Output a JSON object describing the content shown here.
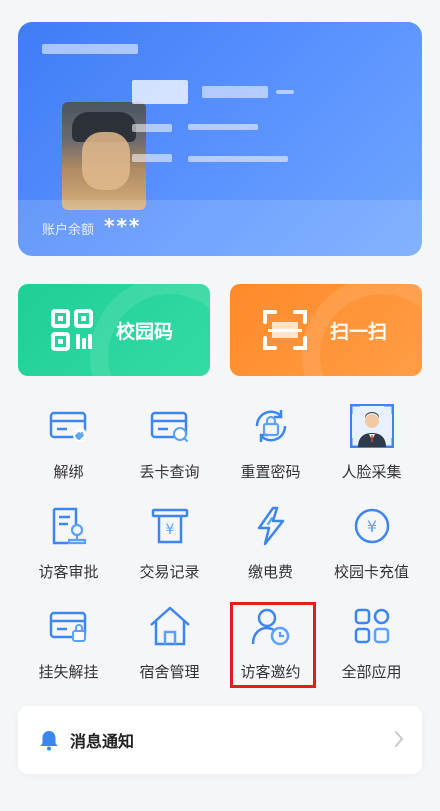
{
  "card": {
    "balance_label": "账户余额",
    "balance_value": "***"
  },
  "actions": {
    "campus_code": "校园码",
    "scan": "扫一扫"
  },
  "apps": [
    {
      "label": "解绑",
      "icon": "card-link-icon"
    },
    {
      "label": "丢卡查询",
      "icon": "card-search-icon"
    },
    {
      "label": "重置密码",
      "icon": "lock-reset-icon"
    },
    {
      "label": "人脸采集",
      "icon": "face-capture-icon"
    },
    {
      "label": "访客审批",
      "icon": "visitor-approval-icon"
    },
    {
      "label": "交易记录",
      "icon": "receipt-icon"
    },
    {
      "label": "缴电费",
      "icon": "lightning-icon"
    },
    {
      "label": "校园卡充值",
      "icon": "yen-coin-icon"
    },
    {
      "label": "挂失解挂",
      "icon": "card-lock-icon"
    },
    {
      "label": "宿舍管理",
      "icon": "house-icon"
    },
    {
      "label": "访客邀约",
      "icon": "visitor-invite-icon"
    },
    {
      "label": "全部应用",
      "icon": "all-apps-icon"
    }
  ],
  "notice": {
    "title": "消息通知"
  },
  "colors": {
    "card_blue": "#4a86f7",
    "green": "#1fcf95",
    "orange": "#ff8a2a",
    "icon_blue": "#3d86f0",
    "highlight_red": "#e01e1e"
  }
}
